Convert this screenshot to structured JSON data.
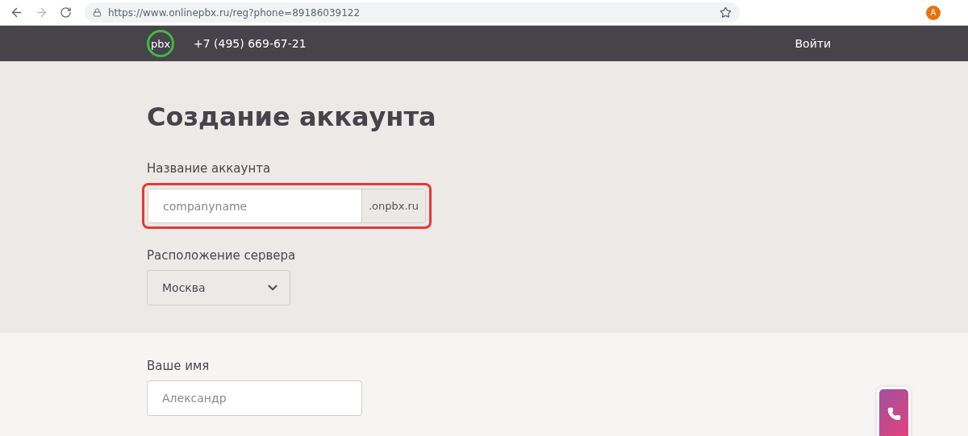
{
  "browser": {
    "url": "https://www.onlinepbx.ru/reg?phone=89186039122",
    "avatar": "A",
    "bookmarked": false
  },
  "header": {
    "logo": "pbx",
    "phone": "+7 (495) 669-67-21",
    "login": "Войти"
  },
  "title": "Создание аккаунта",
  "account": {
    "label": "Название аккаунта",
    "placeholder": "companyname",
    "suffix": ".onpbx.ru",
    "highlighted": true
  },
  "server": {
    "label": "Расположение сервера",
    "value": "Москва"
  },
  "name": {
    "label": "Ваше имя",
    "placeholder": "Александр"
  }
}
